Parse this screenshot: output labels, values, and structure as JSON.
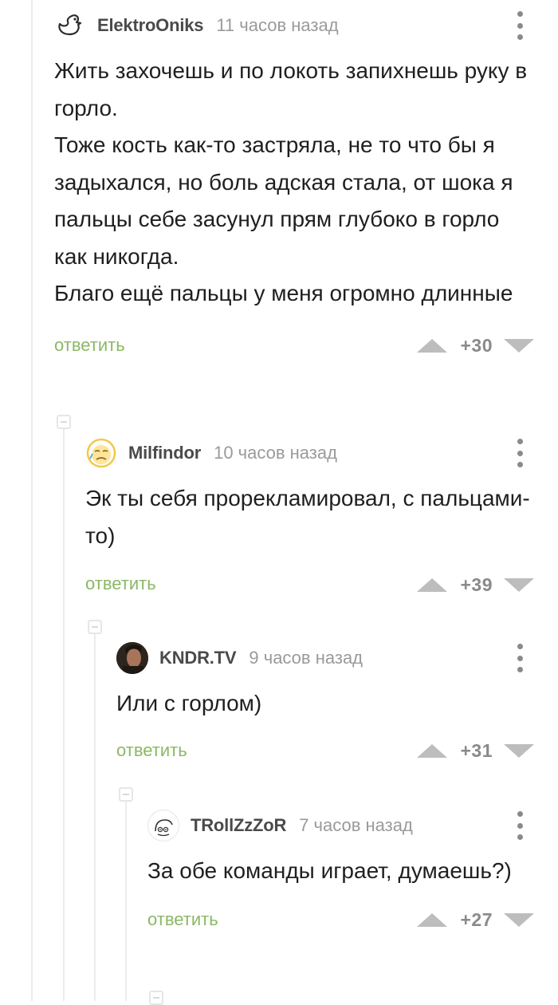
{
  "comments": [
    {
      "author": "ElektroOniks",
      "time": "11 часов назад",
      "avatar_icon": "duck-outline-icon",
      "body": [
        "Жить захочешь и по локоть запихнешь руку в горло.",
        "Тоже кость как-то застряла, не то что бы я задыхался, но боль адская стала, от шока я пальцы себе засунул прям глубоко в горло как никогда.",
        "Благо ещё пальцы у меня огромно длинные"
      ],
      "reply_label": "ответить",
      "score": "+30"
    },
    {
      "author": "Milfindor",
      "time": "10 часов назад",
      "avatar_icon": "crying-emoji-icon",
      "body": [
        "Эк ты себя прорекламировал, с пальцами-то)"
      ],
      "reply_label": "ответить",
      "score": "+39"
    },
    {
      "author": "KNDR.TV",
      "time": "9 часов назад",
      "avatar_icon": "photo-avatar-icon",
      "body": [
        "Или с горлом)"
      ],
      "reply_label": "ответить",
      "score": "+31"
    },
    {
      "author": "TRollZzZoR",
      "time": "7 часов назад",
      "avatar_icon": "troll-face-icon",
      "body": [
        "За обе команды играет, думаешь?)"
      ],
      "reply_label": "ответить",
      "score": "+27"
    }
  ],
  "colors": {
    "reply_green": "#8bb865",
    "vote_gray": "#bdbdbd",
    "thread_line": "#ececec"
  }
}
